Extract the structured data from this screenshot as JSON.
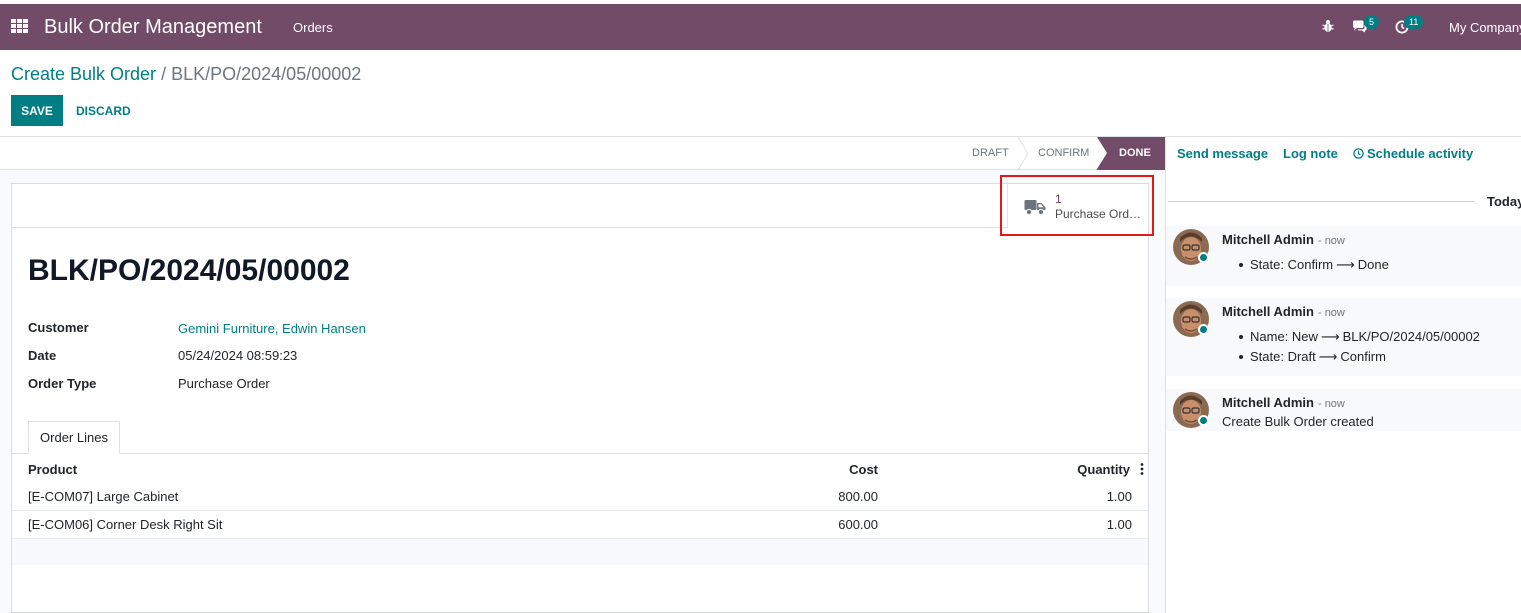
{
  "navbar": {
    "app_name": "Bulk Order Management",
    "menu_orders": "Orders",
    "messages_count": "5",
    "activities_count": "11",
    "company": "My Company"
  },
  "breadcrumb": {
    "parent": "Create Bulk Order",
    "separator": "/",
    "current": "BLK/PO/2024/05/00002"
  },
  "actions": {
    "save": "SAVE",
    "discard": "DISCARD"
  },
  "statusbar": {
    "stages": [
      "DRAFT",
      "CONFIRM",
      "DONE"
    ],
    "active": "DONE"
  },
  "smart_button": {
    "count": "1",
    "label": "Purchase Orders"
  },
  "record": {
    "title": "BLK/PO/2024/05/00002",
    "fields": [
      {
        "label": "Customer",
        "value": "Gemini Furniture, Edwin Hansen"
      },
      {
        "label": "Date",
        "value": "05/24/2024 08:59:23"
      },
      {
        "label": "Order Type",
        "value": "Purchase Order"
      }
    ]
  },
  "tabs": {
    "order_lines": "Order Lines"
  },
  "order_lines": {
    "columns": [
      "Product",
      "Cost",
      "Quantity"
    ],
    "rows": [
      {
        "product": "[E-COM07] Large Cabinet",
        "cost": "800.00",
        "quantity": "1.00"
      },
      {
        "product": "[E-COM06] Corner Desk Right Sit",
        "cost": "600.00",
        "quantity": "1.00"
      }
    ]
  },
  "chatter": {
    "send_message": "Send message",
    "log_note": "Log note",
    "schedule_activity": "Schedule activity",
    "date_separator": "Today",
    "messages": [
      {
        "author": "Mitchell Admin",
        "time": "- now",
        "tracking": [
          {
            "field": "State:",
            "old": "Confirm",
            "new": "Done"
          }
        ]
      },
      {
        "author": "Mitchell Admin",
        "time": "- now",
        "tracking": [
          {
            "field": "Name:",
            "old": "New",
            "new": "BLK/PO/2024/05/00002"
          },
          {
            "field": "State:",
            "old": "Draft",
            "new": "Confirm"
          }
        ]
      },
      {
        "author": "Mitchell Admin",
        "time": "- now",
        "body": "Create Bulk Order created"
      }
    ]
  },
  "colors": {
    "brand": "#714b67",
    "accent": "#017e84",
    "highlight": "#e0191b"
  }
}
